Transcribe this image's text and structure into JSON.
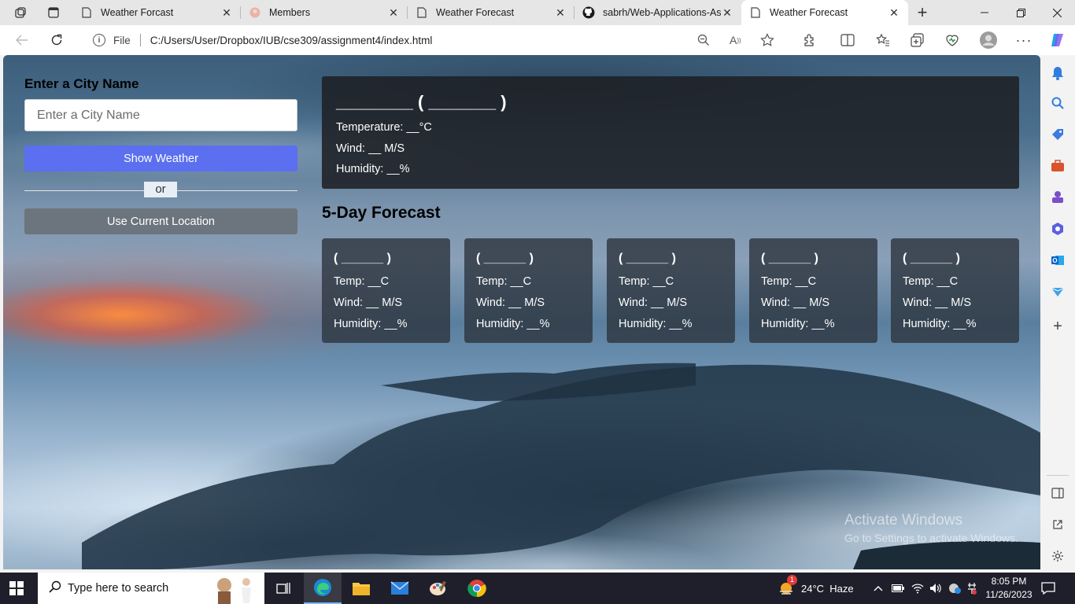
{
  "browser": {
    "tabs": [
      {
        "title": "Weather Forcast",
        "active": false
      },
      {
        "title": "Members",
        "active": false
      },
      {
        "title": "Weather Forecast",
        "active": false
      },
      {
        "title": "sabrh/Web-Applications-As",
        "active": false
      },
      {
        "title": "Weather Forecast",
        "active": true
      }
    ],
    "new_tab": "+",
    "address": {
      "info_icon": "i",
      "file_label": "File",
      "url": "C:/Users/User/Dropbox/IUB/cse309/assignment4/index.html"
    }
  },
  "page": {
    "city_label": "Enter a City Name",
    "city_placeholder": "Enter a City Name",
    "show_button": "Show Weather",
    "or_text": "or",
    "location_button": "Use Current Location",
    "current": {
      "title": "________ ( _______ )",
      "temperature": "Temperature: __°C",
      "wind": "Wind: __ M/S",
      "humidity": "Humidity: __%"
    },
    "forecast_heading": "5-Day Forecast",
    "forecast": [
      {
        "date": "( ______ )",
        "temp": "Temp: __C",
        "wind": "Wind: __ M/S",
        "humidity": "Humidity: __%"
      },
      {
        "date": "( ______ )",
        "temp": "Temp: __C",
        "wind": "Wind: __ M/S",
        "humidity": "Humidity: __%"
      },
      {
        "date": "( ______ )",
        "temp": "Temp: __C",
        "wind": "Wind: __ M/S",
        "humidity": "Humidity: __%"
      },
      {
        "date": "( ______ )",
        "temp": "Temp: __C",
        "wind": "Wind: __ M/S",
        "humidity": "Humidity: __%"
      },
      {
        "date": "( ______ )",
        "temp": "Temp: __C",
        "wind": "Wind: __ M/S",
        "humidity": "Humidity: __%"
      }
    ],
    "watermark": {
      "line1": "Activate Windows",
      "line2": "Go to Settings to activate Windows."
    }
  },
  "taskbar": {
    "search_placeholder": "Type here to search",
    "weather": "24°C  Haze",
    "weather_badge": "1",
    "time": "8:05 PM",
    "date": "11/26/2023"
  },
  "colors": {
    "primary_button": "#5b6ff0",
    "secondary_button": "#6c757d",
    "card_bg": "#1e2024"
  }
}
